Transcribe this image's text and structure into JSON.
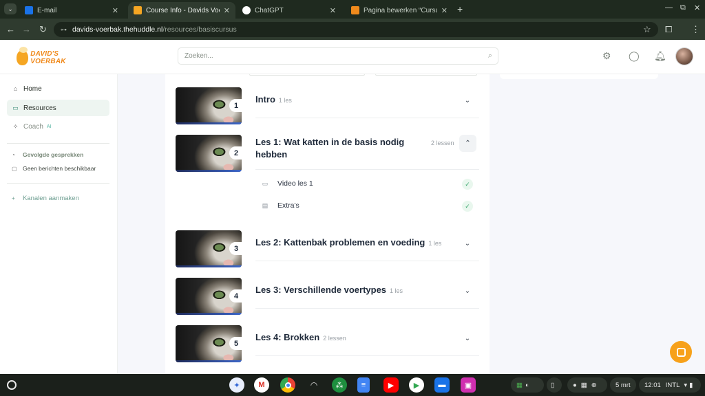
{
  "browser": {
    "tabs": [
      {
        "title": "E-mail",
        "color": "#1a73e8"
      },
      {
        "title": "Course Info - Davids Voerbak",
        "color": "#f5a623"
      },
      {
        "title": "ChatGPT",
        "color": "#ffffff"
      },
      {
        "title": "Pagina bewerken “Cursus” ‹ Da",
        "color": "#f08a1c"
      }
    ],
    "url_host": "davids-voerbak.thehuddle.nl",
    "url_path": "/resources/basiscursus"
  },
  "header": {
    "logo_text": "DAVID'S VOERBAK",
    "search_placeholder": "Zoeken..."
  },
  "sidebar": {
    "home": "Home",
    "resources": "Resources",
    "coach": "Coach",
    "coach_badge": "AI",
    "followed_heading": "Gevolgde gesprekken",
    "no_messages": "Geen berichten beschikbaar",
    "create_channels": "Kanalen aanmaken"
  },
  "lessons": [
    {
      "num": "1",
      "title": "Intro",
      "count": "1 les"
    },
    {
      "num": "2",
      "title": "Les 1: Wat katten in de basis nodig hebben",
      "count": "2 lessen",
      "items": [
        {
          "label": "Video les 1",
          "icon": "video-icon"
        },
        {
          "label": "Extra's",
          "icon": "document-icon"
        }
      ]
    },
    {
      "num": "3",
      "title": "Les 2: Kattenbak problemen en voeding",
      "count": "1 les"
    },
    {
      "num": "4",
      "title": "Les 3: Verschillende voertypes",
      "count": "1 les"
    },
    {
      "num": "5",
      "title": "Les 4: Brokken",
      "count": "2 lessen"
    }
  ],
  "shelf": {
    "date": "5 mrt",
    "time": "12:01",
    "keyboard": "INTL"
  }
}
